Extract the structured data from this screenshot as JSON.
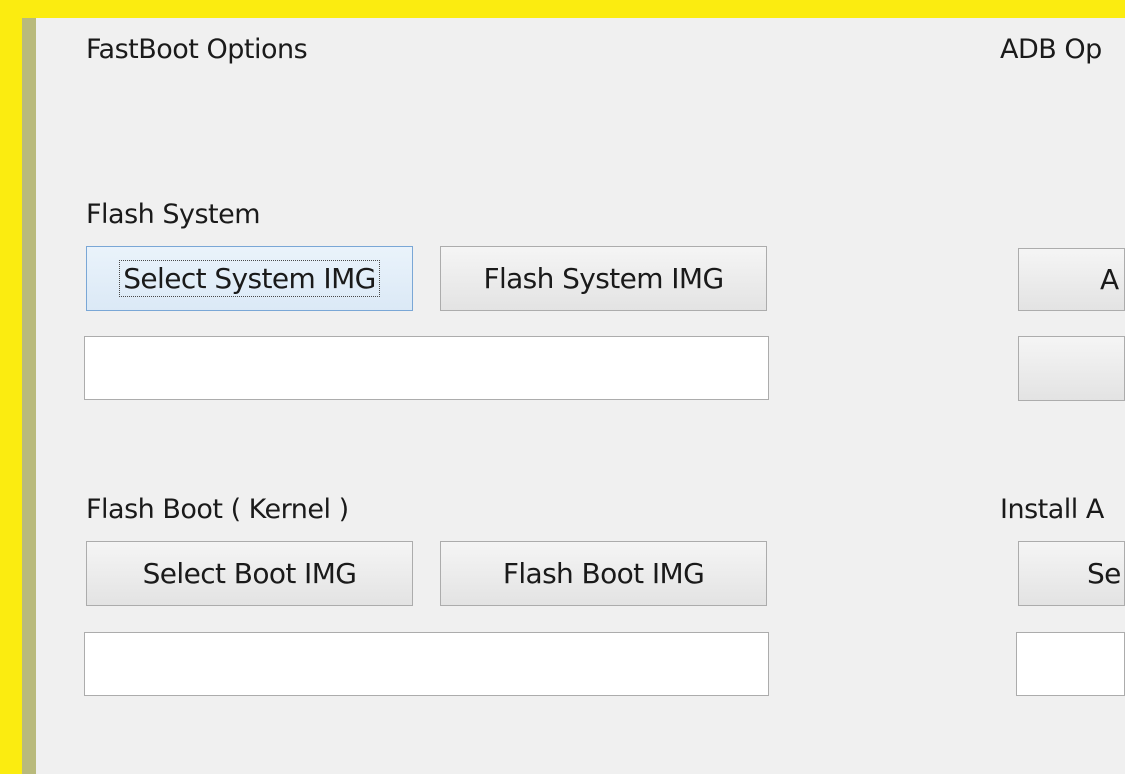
{
  "fastboot": {
    "title": "FastBoot Options",
    "flash_system": {
      "label": "Flash System",
      "select_button": "Select System IMG",
      "flash_button": "Flash System IMG",
      "path_value": ""
    },
    "flash_boot": {
      "label": "Flash Boot ( Kernel )",
      "select_button": "Select Boot IMG",
      "flash_button": "Flash Boot IMG",
      "path_value": ""
    }
  },
  "adb": {
    "title": "ADB Op",
    "button_1": "A",
    "button_2": "",
    "install_label": "Install A",
    "install_select_button": "Se",
    "install_path_value": ""
  }
}
